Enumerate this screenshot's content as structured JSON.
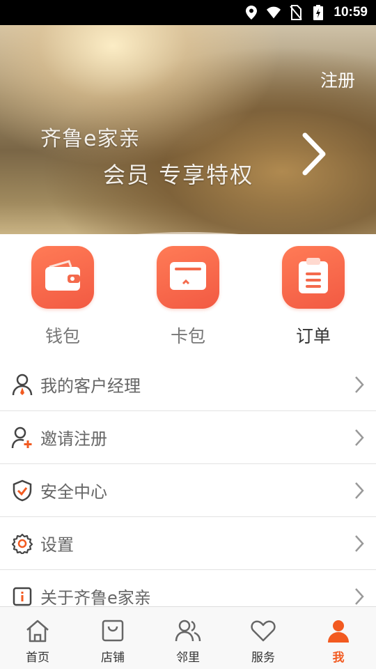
{
  "status_bar": {
    "time": "10:59"
  },
  "hero": {
    "register_label": "注册",
    "title_line1": "齐鲁e家亲",
    "title_line2": "会员 专享特权"
  },
  "quick_actions": [
    {
      "label": "钱包",
      "icon": "wallet-icon"
    },
    {
      "label": "卡包",
      "icon": "card-icon"
    },
    {
      "label": "订单",
      "icon": "clipboard-icon"
    }
  ],
  "menu": [
    {
      "label": "我的客户经理",
      "icon": "manager-icon"
    },
    {
      "label": "邀请注册",
      "icon": "add-user-icon"
    },
    {
      "label": "安全中心",
      "icon": "shield-check-icon"
    },
    {
      "label": "设置",
      "icon": "gear-icon"
    },
    {
      "label": "关于齐鲁e家亲",
      "icon": "info-icon"
    }
  ],
  "tabs": [
    {
      "label": "首页",
      "icon": "home-icon"
    },
    {
      "label": "店铺",
      "icon": "shop-bag-icon"
    },
    {
      "label": "邻里",
      "icon": "neighbors-icon"
    },
    {
      "label": "服务",
      "icon": "heart-icon"
    },
    {
      "label": "我",
      "icon": "user-icon",
      "active": true
    }
  ],
  "colors": {
    "accent": "#F25A20",
    "icon_gradient_start": "#FF7B56",
    "icon_gradient_end": "#F25A43"
  }
}
